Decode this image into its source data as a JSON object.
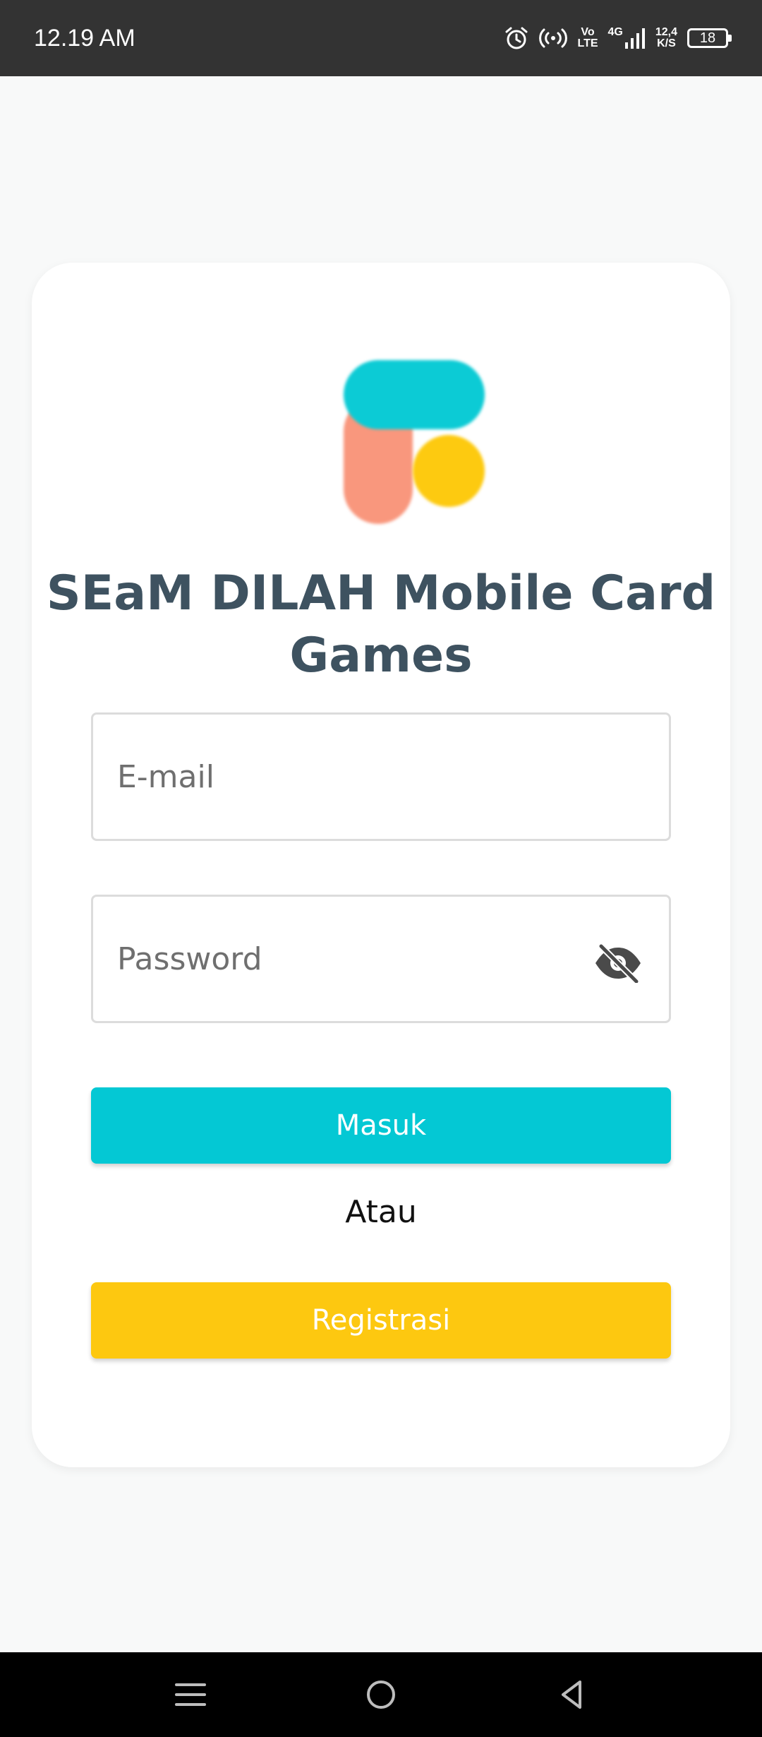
{
  "status_bar": {
    "time": "12.19 AM",
    "volte_top": "Vo",
    "volte_bottom": "LTE",
    "network": "4G",
    "speed_top": "12,4",
    "speed_bottom": "K/S",
    "battery": "18",
    "icons": [
      "alarm-icon",
      "hotspot-icon",
      "volte-icon",
      "signal-icon",
      "data-speed-icon",
      "battery-icon"
    ]
  },
  "login": {
    "logo_colors": {
      "bar_vertical": "#f9977d",
      "bar_horizontal": "#0ccbd5",
      "dot": "#fdca10"
    },
    "title": "SEaM DILAH Mobile Card Games",
    "email_placeholder": "E-mail",
    "email_value": "",
    "password_placeholder": "Password",
    "password_value": "",
    "password_toggle_icon": "eye-off-icon",
    "login_label": "Masuk",
    "or_label": "Atau",
    "register_label": "Registrasi"
  },
  "colors": {
    "primary": "#04c8d4",
    "secondary": "#fdc810",
    "title": "#3e5260",
    "status_bar": "#333333",
    "nav_bar": "#000000"
  },
  "nav_bar": {
    "icons": [
      "menu-icon",
      "home-icon",
      "back-icon"
    ]
  }
}
